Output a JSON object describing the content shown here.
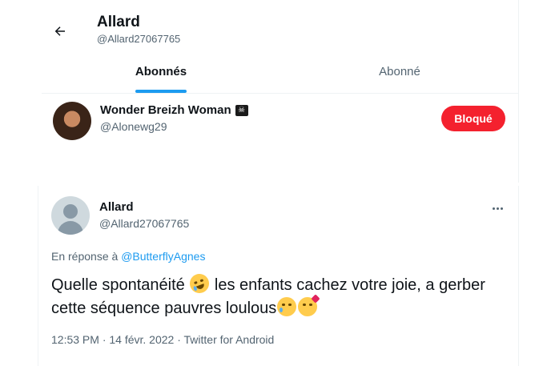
{
  "header": {
    "back_icon": "arrow-left-icon",
    "name": "Allard",
    "handle": "@Allard27067765"
  },
  "tabs": [
    {
      "label": "Abonnés",
      "active": true
    },
    {
      "label": "Abonné",
      "active": false
    }
  ],
  "blocked_user": {
    "name": "Wonder Breizh Woman",
    "flag_icon": "pirate-flag-icon",
    "handle": "@Alonewg29",
    "button_label": "Bloqué",
    "button_color": "#f4212e"
  },
  "tweet": {
    "author_name": "Allard",
    "author_handle": "@Allard27067765",
    "reply_prefix": "En réponse à",
    "reply_to": "@ButterflyAgnes",
    "text_part1": "Quelle spontanéité",
    "text_part2": "les enfants cachez votre joie, a gerber cette séquence pauvres loulous",
    "emojis": [
      "rolling-on-floor-laughing-icon",
      "crying-face-icon",
      "face-blowing-kiss-icon"
    ],
    "meta": "12:53 PM · 14 févr. 2022 · Twitter for Android"
  },
  "colors": {
    "accent": "#1d9bf0",
    "secondary_text": "#536471",
    "danger": "#f4212e"
  }
}
